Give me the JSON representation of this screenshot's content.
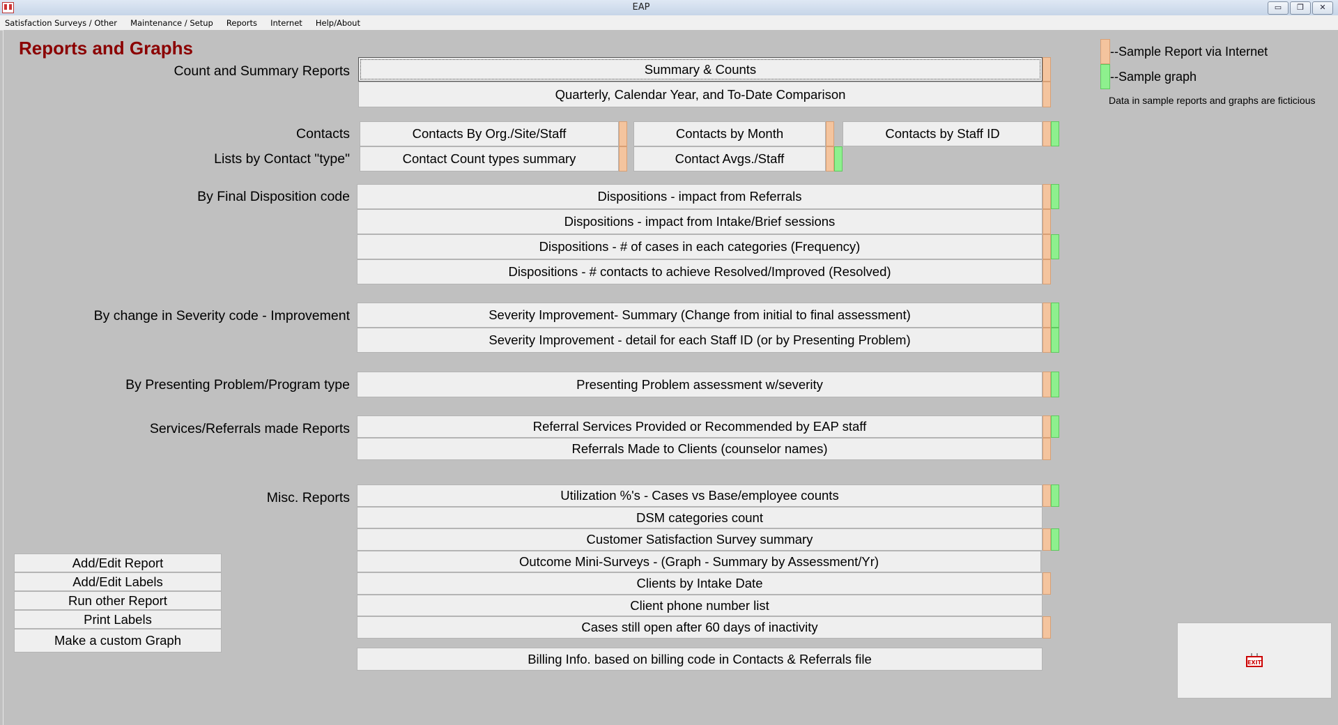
{
  "window": {
    "title": "EAP",
    "controls": {
      "minimize": "▭",
      "restore": "❐",
      "close": "✕"
    }
  },
  "menu": [
    "Satisfaction Surveys / Other",
    "Maintenance / Setup",
    "Reports",
    "Internet",
    "Help/About"
  ],
  "page": {
    "title": "Reports and Graphs"
  },
  "colors": {
    "title": "#8b0000",
    "internet_marker": "#f4c49e",
    "graph_marker": "#8ef08e",
    "background": "#c0c0c0"
  },
  "legend": {
    "internet": "--Sample Report via Internet",
    "graph": "--Sample graph",
    "note": "Data in sample reports and graphs are ficticious"
  },
  "sections": {
    "count_summary": "Count and Summary Reports",
    "contacts": "Contacts",
    "lists_by_type": "Lists by Contact \"type\"",
    "disposition": "By Final Disposition code",
    "severity": "By change in Severity code - Improvement",
    "presenting": "By Presenting Problem/Program type",
    "services": "Services/Referrals made Reports",
    "misc": "Misc. Reports"
  },
  "buttons": {
    "summary_counts": "Summary & Counts",
    "quarterly": "Quarterly, Calendar Year, and To-Date Comparison",
    "contacts_org": "Contacts By Org./Site/Staff",
    "contacts_month": "Contacts by Month",
    "contacts_staff": "Contacts by Staff ID",
    "contact_types": "Contact Count types summary",
    "contact_avgs": "Contact Avgs./Staff",
    "disp_referrals": "Dispositions - impact from Referrals",
    "disp_intake": "Dispositions - impact from Intake/Brief sessions",
    "disp_frequency": "Dispositions - # of cases in each categories (Frequency)",
    "disp_resolved": "Dispositions - # contacts to achieve Resolved/Improved (Resolved)",
    "sev_summary": "Severity Improvement- Summary (Change from initial to final assessment)",
    "sev_detail": "Severity Improvement - detail for each Staff ID (or by Presenting Problem)",
    "presenting": "Presenting Problem assessment w/severity",
    "referral_services": "Referral Services Provided or Recommended by EAP staff",
    "referrals_made": "Referrals Made to Clients (counselor names)",
    "utilization": "Utilization %'s - Cases vs Base/employee counts",
    "dsm": "DSM categories count",
    "satisfaction": "Customer Satisfaction Survey summary",
    "outcome": "Outcome Mini-Surveys - (Graph - Summary by Assessment/Yr)",
    "intake_date": "Clients by Intake Date",
    "phone_list": "Client phone number list",
    "open_cases": "Cases still open after 60 days of inactivity",
    "billing": "Billing Info. based on billing code in Contacts & Referrals file",
    "add_edit_report": "Add/Edit Report",
    "add_edit_labels": "Add/Edit Labels",
    "run_other": "Run other Report",
    "print_labels": "Print Labels",
    "custom_graph": "Make a custom Graph"
  },
  "exit": {
    "icon": "exit-sign-icon",
    "label": "EXIT"
  }
}
